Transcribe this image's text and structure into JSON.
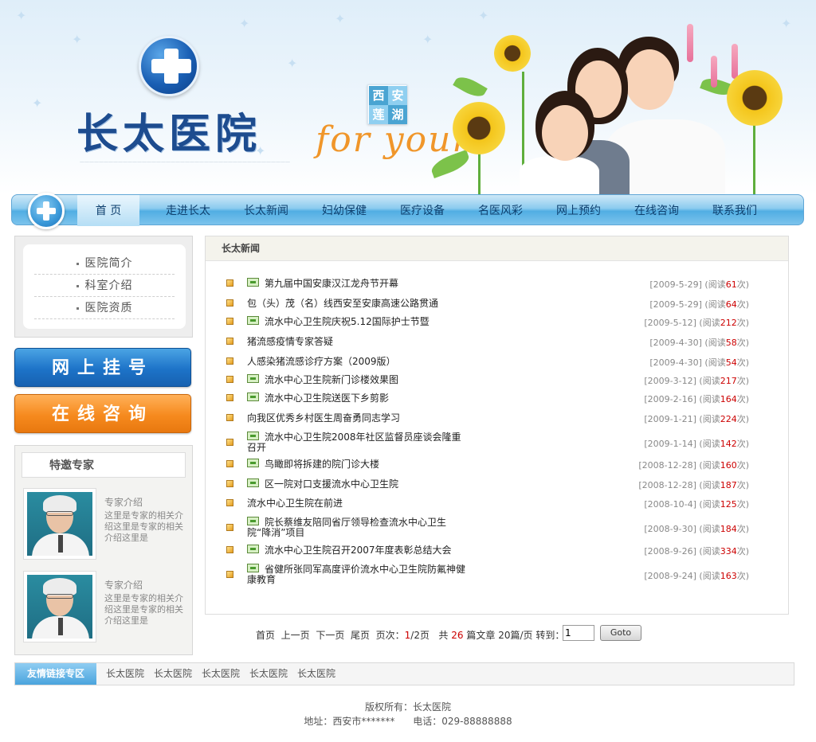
{
  "header": {
    "brand_name": "长太医院",
    "badge": [
      "西",
      "安",
      "莲",
      "湖"
    ],
    "slogan": "for your"
  },
  "nav": {
    "items": [
      "首 页",
      "走进长太",
      "长太新闻",
      "妇幼保健",
      "医疗设备",
      "名医风彩",
      "网上预约",
      "在线咨询",
      "联系我们"
    ],
    "active_index": 0
  },
  "left_menu": {
    "items": [
      "医院简介",
      "科室介绍",
      "医院资质"
    ]
  },
  "buttons": {
    "register": "网上挂号",
    "consult": "在线咨询"
  },
  "experts": {
    "title": "特邀专家",
    "items": [
      {
        "name": "专家介绍",
        "desc": "这里是专家的相关介绍这里是专家的相关介绍这里是"
      },
      {
        "name": "专家介绍",
        "desc": "这里是专家的相关介绍这里是专家的相关介绍这里是"
      }
    ]
  },
  "news": {
    "section_title": "长太新闻",
    "read_prefix": "阅读",
    "read_suffix": "次",
    "items": [
      {
        "title": "第九届中国安康汉江龙舟节开幕",
        "date": "2009-5-29",
        "reads": "61",
        "img": true
      },
      {
        "title": "包（头）茂（名）线西安至安康高速公路贯通",
        "date": "2009-5-29",
        "reads": "64",
        "img": false
      },
      {
        "title": "流水中心卫生院庆祝5.12国际护士节暨",
        "date": "2009-5-12",
        "reads": "212",
        "img": true
      },
      {
        "title": "猪流感疫情专家答疑",
        "date": "2009-4-30",
        "reads": "58",
        "img": false
      },
      {
        "title": "人感染猪流感诊疗方案（2009版）",
        "date": "2009-4-30",
        "reads": "54",
        "img": false
      },
      {
        "title": "流水中心卫生院新门诊楼效果图",
        "date": "2009-3-12",
        "reads": "217",
        "img": true
      },
      {
        "title": "流水中心卫生院送医下乡剪影",
        "date": "2009-2-16",
        "reads": "164",
        "img": true
      },
      {
        "title": "向我区优秀乡村医生周奋勇同志学习",
        "date": "2009-1-21",
        "reads": "224",
        "img": false
      },
      {
        "title": "流水中心卫生院2008年社区监督员座谈会隆重召开",
        "date": "2009-1-14",
        "reads": "142",
        "img": true
      },
      {
        "title": "鸟瞰即将拆建的院门诊大楼",
        "date": "2008-12-28",
        "reads": "160",
        "img": true
      },
      {
        "title": "区一院对口支援流水中心卫生院",
        "date": "2008-12-28",
        "reads": "187",
        "img": true
      },
      {
        "title": "流水中心卫生院在前进",
        "date": "2008-10-4",
        "reads": "125",
        "img": false
      },
      {
        "title": "院长蔡维友陪同省厅领导检查流水中心卫生院“降消”项目",
        "date": "2008-9-30",
        "reads": "184",
        "img": true
      },
      {
        "title": "流水中心卫生院召开2007年度表彰总结大会",
        "date": "2008-9-26",
        "reads": "334",
        "img": true
      },
      {
        "title": "省健所张同军高度评价流水中心卫生院防氟神健康教育",
        "date": "2008-9-24",
        "reads": "163",
        "img": true
      }
    ]
  },
  "pager": {
    "first": "首页",
    "prev": "上一页",
    "next": "下一页",
    "last": "尾页",
    "page_label": "页次：",
    "current_page": "1",
    "total_pages": "/2页",
    "total_prefix": "共",
    "total_count": "26",
    "total_suffix": "篇文章",
    "per_page": "20篇/页",
    "goto_label": "转到：",
    "input_value": "1",
    "goto_button": "Goto"
  },
  "links": {
    "label": "友情链接专区",
    "items": [
      "长太医院",
      "长太医院",
      "长太医院",
      "长太医院",
      "长太医院"
    ]
  },
  "footer": {
    "copyright": "版权所有：长太医院",
    "address": "地址：西安市*******",
    "phone": "电话：029-88888888"
  },
  "colors": {
    "nav_blue": "#51aee3",
    "register_blue": "#1d73c8",
    "consult_orange": "#f68a1e",
    "read_count_red": "#cc0000"
  }
}
